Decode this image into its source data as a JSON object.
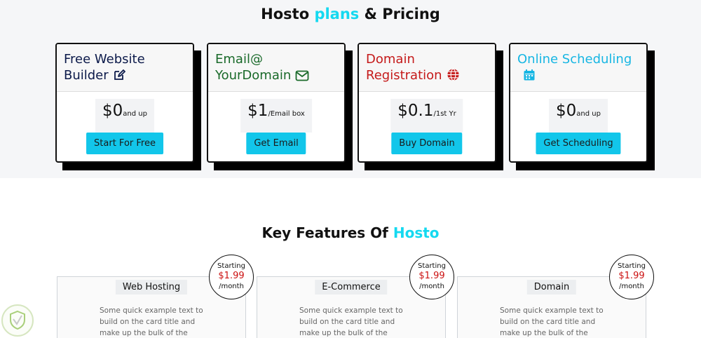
{
  "plans": {
    "title_pre": "Hosto ",
    "title_accent": "plans",
    "title_post": " & Pricing",
    "cards": [
      {
        "line1": "Free Website",
        "line2": "Builder",
        "icon": "edit-icon",
        "color": "#0c1a4a",
        "price": "$0",
        "unit": "and up",
        "button": "Start For Free"
      },
      {
        "line1": "Email@",
        "line2": "YourDomain",
        "icon": "envelope-icon",
        "color": "#1a6a2a",
        "price": "$1",
        "unit": "/Email box",
        "button": "Get Email"
      },
      {
        "line1": "Domain",
        "line2": "Registration",
        "icon": "globe-icon",
        "color": "#c51a1a",
        "price": "$0.1",
        "unit": "/1st Yr",
        "button": "Buy Domain"
      },
      {
        "line1": "Online Scheduling",
        "line2": "",
        "icon": "calendar-icon",
        "color": "#17b6e3",
        "price": "$0",
        "unit": "and up",
        "button": "Get Scheduling"
      }
    ]
  },
  "features": {
    "title_pre": "Key Features Of ",
    "title_accent": "Hosto",
    "cards": [
      {
        "label": "Web Hosting",
        "text_lines": [
          "Some quick example text to",
          "build on the card title and",
          "make up the bulk of the card's"
        ],
        "starting": "Starting",
        "price": "$1.99",
        "period": "/month"
      },
      {
        "label": "E-Commerce",
        "text_lines": [
          "Some quick example text to",
          "build on the card title and",
          "make up the bulk of the card's"
        ],
        "starting": "Starting",
        "price": "$1.99",
        "period": "/month"
      },
      {
        "label": "Domain",
        "text_lines": [
          "Some quick example text to",
          "build on the card title and",
          "make up the bulk of the card's"
        ],
        "starting": "Starting",
        "price": "$1.99",
        "period": "/month"
      }
    ]
  },
  "colors": {
    "accent": "#14d9f0",
    "button": "#12c6ea",
    "price_red": "#cc1111"
  }
}
